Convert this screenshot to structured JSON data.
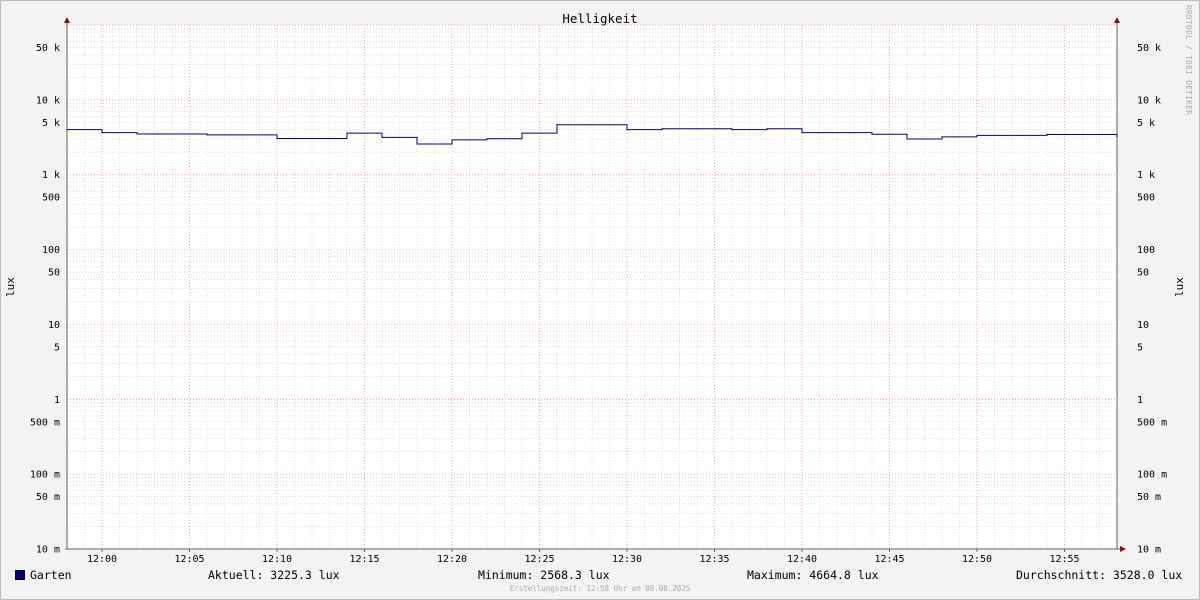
{
  "chart_data": {
    "type": "line",
    "title": "Helligkeit",
    "ylabel": "lux",
    "yscale": "log",
    "ylim": [
      0.01,
      100000
    ],
    "grid": true,
    "x_ticks": [
      "12:00",
      "12:05",
      "12:10",
      "12:15",
      "12:20",
      "12:25",
      "12:30",
      "12:35",
      "12:40",
      "12:45",
      "12:50",
      "12:55"
    ],
    "y_ticks": [
      {
        "value": 50000,
        "label": "50 k"
      },
      {
        "value": 10000,
        "label": "10 k"
      },
      {
        "value": 5000,
        "label": "5 k"
      },
      {
        "value": 1000,
        "label": "1 k"
      },
      {
        "value": 500,
        "label": "500"
      },
      {
        "value": 100,
        "label": "100"
      },
      {
        "value": 50,
        "label": "50"
      },
      {
        "value": 10,
        "label": "10"
      },
      {
        "value": 5,
        "label": "5"
      },
      {
        "value": 1,
        "label": "1"
      },
      {
        "value": 0.5,
        "label": "500 m"
      },
      {
        "value": 0.1,
        "label": "100 m"
      },
      {
        "value": 0.05,
        "label": "50 m"
      },
      {
        "value": 0.01,
        "label": "10 m"
      }
    ],
    "series": [
      {
        "name": "Garten",
        "color": "#000080",
        "x": [
          "11:58",
          "12:00",
          "12:02",
          "12:06",
          "12:10",
          "12:14",
          "12:16",
          "12:18",
          "12:20",
          "12:22",
          "12:24",
          "12:26",
          "12:30",
          "12:32",
          "12:36",
          "12:38",
          "12:40",
          "12:44",
          "12:46",
          "12:48",
          "12:50",
          "12:54",
          "12:58"
        ],
        "values": [
          4000,
          3650,
          3500,
          3400,
          3050,
          3600,
          3150,
          2570,
          2920,
          3020,
          3600,
          4650,
          4000,
          4100,
          4000,
          4100,
          3650,
          3480,
          3000,
          3200,
          3350,
          3450,
          3225
        ]
      }
    ]
  },
  "legend": {
    "series_name": "Garten",
    "aktuell": "Aktuell: 3225.3 lux",
    "minimum": "Minimum: 2568.3 lux",
    "maximum": "Maximum: 4664.8 lux",
    "durchschnitt": "Durchschnitt: 3528.0 lux"
  },
  "footer": "Erstellungszeit: 12:58 Uhr am 08.08.2025",
  "watermark": "RRDTOOL / TOBI OETIKER",
  "colors": {
    "line": "#000080",
    "major_grid": "#ff8080",
    "minor_grid": "#c8c8c8",
    "axis": "#606060",
    "arrow": "#801010"
  }
}
